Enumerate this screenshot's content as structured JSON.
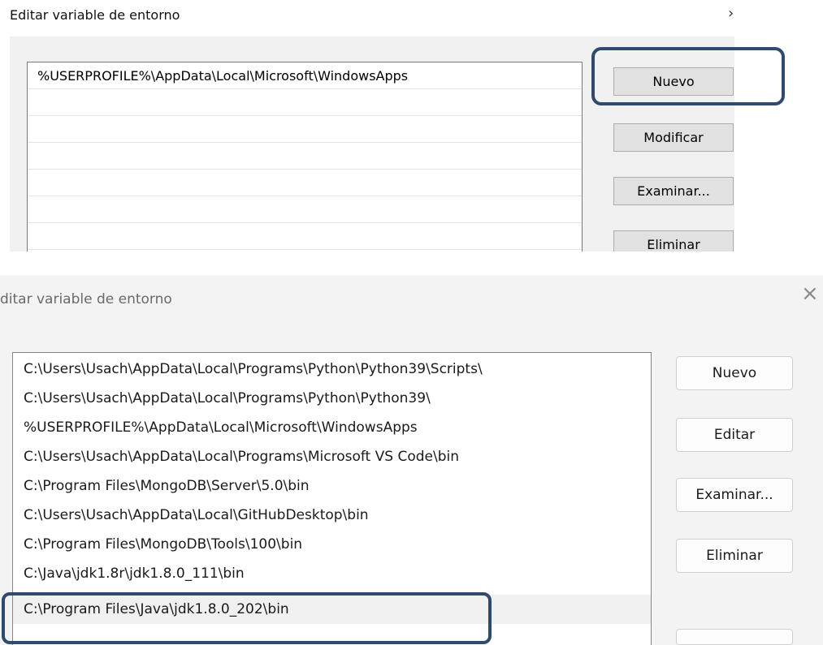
{
  "top_dialog": {
    "title": "Editar variable de entorno",
    "close_glyph": "›",
    "items": [
      "%USERPROFILE%\\AppData\\Local\\Microsoft\\WindowsApps",
      "",
      "",
      "",
      "",
      "",
      ""
    ],
    "buttons": {
      "new": "Nuevo",
      "edit": "Modificar",
      "browse": "Examinar...",
      "delete": "Eliminar"
    },
    "highlight_color": "#2f4a6e"
  },
  "bottom_dialog": {
    "title": "ditar variable de entorno",
    "close_glyph": "×",
    "items": [
      "C:\\Users\\Usach\\AppData\\Local\\Programs\\Python\\Python39\\Scripts\\",
      "C:\\Users\\Usach\\AppData\\Local\\Programs\\Python\\Python39\\",
      "%USERPROFILE%\\AppData\\Local\\Microsoft\\WindowsApps",
      "C:\\Users\\Usach\\AppData\\Local\\Programs\\Microsoft VS Code\\bin",
      "C:\\Program Files\\MongoDB\\Server\\5.0\\bin",
      "C:\\Users\\Usach\\AppData\\Local\\GitHubDesktop\\bin",
      "C:\\Program Files\\MongoDB\\Tools\\100\\bin",
      "C:\\Java\\jdk1.8r\\jdk1.8.0_111\\bin",
      "C:\\Program Files\\Java\\jdk1.8.0_202\\bin"
    ],
    "selected_index": 8,
    "buttons": {
      "new": "Nuevo",
      "edit": "Editar",
      "browse": "Examinar...",
      "delete": "Eliminar"
    },
    "highlight_color": "#2f4a6e"
  }
}
